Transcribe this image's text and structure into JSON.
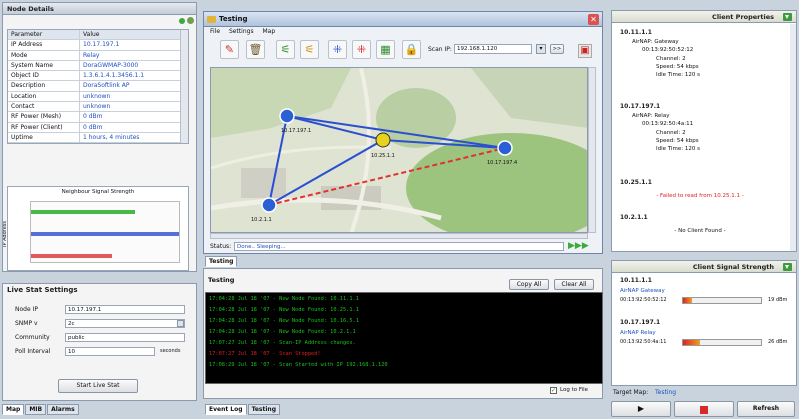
{
  "node_details": {
    "title": "Node Details",
    "columns": [
      "Parameter",
      "Value"
    ],
    "rows": [
      {
        "k": "IP Address",
        "v": "10.17.197.1"
      },
      {
        "k": "Mode",
        "v": "Relay"
      },
      {
        "k": "System Name",
        "v": "DoraGWMAP-3000"
      },
      {
        "k": "Object ID",
        "v": "1.3.6.1.4.1.3456.1.1"
      },
      {
        "k": "Description",
        "v": "DoraSoftlink AP"
      },
      {
        "k": "Location",
        "v": "unknown"
      },
      {
        "k": "Contact",
        "v": "unknown"
      },
      {
        "k": "RF Power (Mesh)",
        "v": "0 dBm"
      },
      {
        "k": "RF Power (Client)",
        "v": "0 dBm"
      },
      {
        "k": "Uptime",
        "v": "1 hours, 4 minutes"
      }
    ],
    "chart_title": "Neighbour Signal Strength",
    "y_label": "IP Address"
  },
  "live_stat": {
    "title": "Live Stat Settings",
    "node_ip_label": "Node IP",
    "node_ip_value": "10.17.197.1",
    "snmp_label": "SNMP v",
    "snmp_value": "2c",
    "community_label": "Community",
    "community_value": "public",
    "poll_label": "Poll Interval",
    "poll_value": "10",
    "poll_unit": "seconds",
    "start_button": "Start Live Stat"
  },
  "left_tabs": [
    "Map",
    "MIB",
    "Alarms"
  ],
  "testing_window": {
    "title": "Testing",
    "menu": [
      "File",
      "Settings",
      "Map"
    ],
    "scan_ip_label": "Scan IP:",
    "scan_ip_value": "192.168.1.120",
    "go_label": ">>",
    "status_label": "Status:",
    "status_value": "Done.. Sleeping...",
    "nodes": [
      {
        "label": "10.17.197.1"
      },
      {
        "label": "10.25.1.1"
      },
      {
        "label": "10.2.1.1"
      },
      {
        "label": "10.17.197.4"
      }
    ]
  },
  "mid_tab": "Testing",
  "log_panel": {
    "title": "Testing",
    "copy_all": "Copy All",
    "clear_all": "Clear All",
    "lines": [
      {
        "text": "17:04:28 Jul 18 '07   - New Node Found: 10.11.1.1",
        "color": "#19c219"
      },
      {
        "text": "17:04:28 Jul 18 '07   - New Node Found: 10.25.1.1",
        "color": "#19c219"
      },
      {
        "text": "17:04:28 Jul 18 '07   - New Node Found: 10.16.5.1",
        "color": "#19c219"
      },
      {
        "text": "17:04:28 Jul 18 '07   - New Node Found: 10.2.1.1",
        "color": "#19c219"
      },
      {
        "text": "17:07:27 Jul 18 '07   - Scan-IP Address changes.",
        "color": "#19c219"
      },
      {
        "text": "17:07:27 Jul 18 '07   - Scan Stopped!",
        "color": "#e02020"
      },
      {
        "text": "17:08:29 Jul 18 '07   - Scan Started with IP 192.168.1.120",
        "color": "#19c219"
      }
    ],
    "log_to_file": "Log to File"
  },
  "bottom_tabs": [
    "Event Log",
    "Testing"
  ],
  "client_properties": {
    "title": "Client Properties",
    "nodes": [
      {
        "ip": "10.11.1.1",
        "name": "AirNAP: Gateway",
        "mac": "00:13:92:50:52:12",
        "details": [
          "Channel: 2",
          "Speed: 54 kbps",
          "Idle Time: 120 s"
        ]
      },
      {
        "ip": "10.17.197.1",
        "name": "AirNAP: Relay",
        "mac": "00:13:92:50:4a:11",
        "details": [
          "Channel: 2",
          "Speed: 54 kbps",
          "Idle Time: 120 s"
        ]
      },
      {
        "ip": "10.25.1.1",
        "message": "- Failed to read from 10.25.1.1 -"
      },
      {
        "ip": "10.2.1.1",
        "message": "- No Client Found -"
      }
    ]
  },
  "client_signal": {
    "title": "Client Signal Strength",
    "entries": [
      {
        "ip": "10.11.1.1",
        "name": "AirNAP Gateway",
        "mac": "00:13:92:50:52:12",
        "value": "19 dBm",
        "level": 0.12
      },
      {
        "ip": "10.17.197.1",
        "name": "AirNAP Relay",
        "mac": "00:13:92:50:4a:11",
        "value": "26 dBm",
        "level": 0.22
      }
    ],
    "target_map_label": "Target Map:",
    "target_map_value": "Testing",
    "refresh": "Refresh"
  },
  "colors": {
    "link_blue": "#1f4fbf",
    "node_blue": "#2a5fd6",
    "link_red": "#e03030",
    "gateway_green": "#3faa3f"
  }
}
